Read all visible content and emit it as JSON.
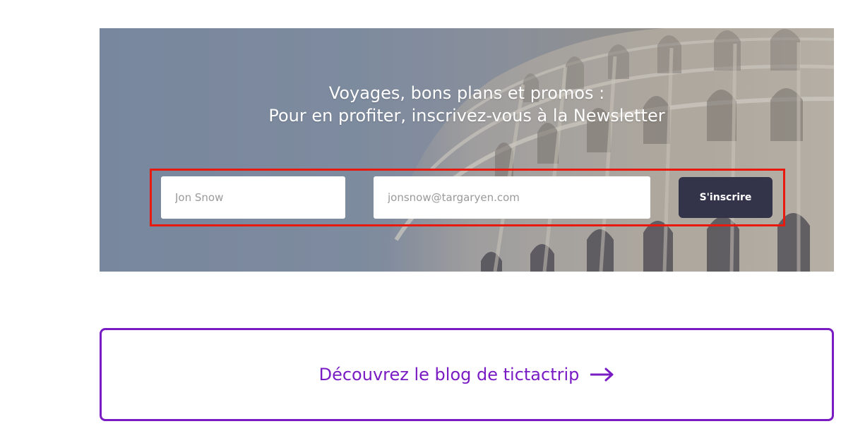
{
  "newsletter": {
    "title_line1": "Voyages, bons plans et promos :",
    "title_line2": "Pour en profiter, inscrivez-vous à la Newsletter",
    "name_placeholder": "Jon Snow",
    "email_placeholder": "jonsnow@targaryen.com",
    "submit_label": "S'inscrire"
  },
  "blog": {
    "link_label": "Découvrez le blog de tictactrip",
    "arrow_icon": "arrow-right-icon"
  },
  "colors": {
    "accent_purple": "#7a1cc4",
    "button_dark": "#33344a",
    "highlight_red": "#e8190f"
  }
}
